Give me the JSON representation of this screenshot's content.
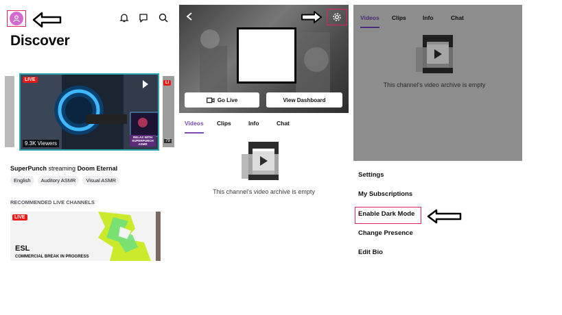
{
  "panel1": {
    "title": "Discover",
    "featured": {
      "live_label": "LIVE",
      "viewers": "9.3K Viewers",
      "overlay_text": "RELAX WITH SUPERPUNCH ASMR"
    },
    "side_thumb_right_label": "79",
    "stream": {
      "channel": "SuperPunch",
      "middle": "streaming",
      "game": "Doom Eternal"
    },
    "tags": [
      "English",
      "Auditory ASMR",
      "Visual ASMR"
    ],
    "section_title": "RECOMMENDED LIVE CHANNELS",
    "recommended": {
      "live_label": "LIVE",
      "brand": "ESL",
      "caption": "COMMERCIAL BREAK IN PROGRESS"
    },
    "icons": [
      "avatar-icon",
      "bell-icon",
      "chat-bubble-icon",
      "search-icon"
    ]
  },
  "panel2": {
    "go_live": "Go Live",
    "view_dashboard": "View Dashboard",
    "tabs": [
      "Videos",
      "Clips",
      "Info",
      "Chat"
    ],
    "empty_message": "This channel's video archive is empty"
  },
  "panel3": {
    "tabs": [
      "Videos",
      "Clips",
      "Info",
      "Chat"
    ],
    "empty_message": "This channel's video archive is empty",
    "menu": [
      "Settings",
      "My Subscriptions",
      "Enable Dark Mode",
      "Change Presence",
      "Edit Bio"
    ]
  },
  "colors": {
    "accent_purple": "#7b4bb5",
    "highlight_red": "#e0245e",
    "live_red": "#e91916"
  }
}
